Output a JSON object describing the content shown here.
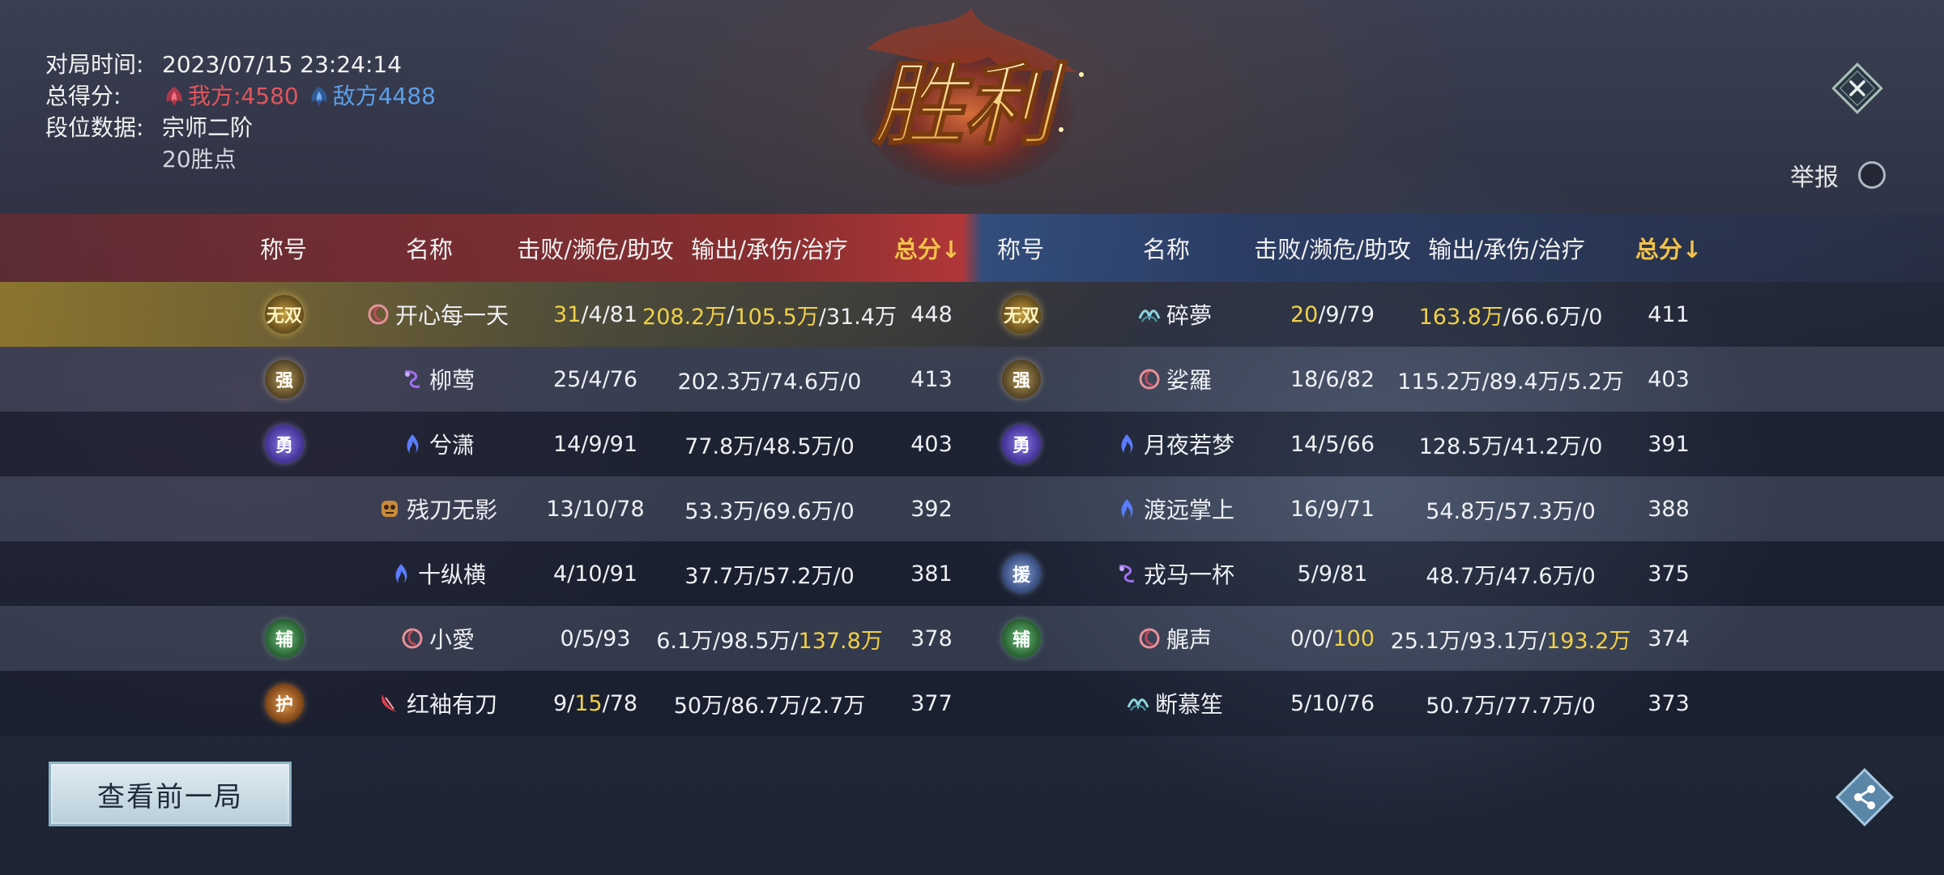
{
  "match": {
    "time_label": "对局时间:",
    "time_value": "2023/07/15 23:24:14",
    "score_label": "总得分:",
    "our_score": "我方:4580",
    "enemy_score": "敌方4488",
    "rank_label": "段位数据:",
    "rank_value": "宗师二阶",
    "rank_points": "20胜点"
  },
  "result": {
    "title": "胜利"
  },
  "report": {
    "label": "举报"
  },
  "headers": {
    "title": "称号",
    "name": "名称",
    "kda": "击败/濒危/助攻",
    "dmg": "输出/承伤/治疗",
    "total": "总分↓"
  },
  "our_team": [
    {
      "badge": "无双",
      "badge_style": "gold",
      "class_icon": "pink-spiral-icon",
      "name": "开心每一天",
      "kda_k": "31",
      "kda_rest": "/4/81",
      "dmg_out": "208.2万",
      "dmg_sep1": "/",
      "dmg_taken": "105.5万",
      "dmg_rest": "/31.4万",
      "total": "448"
    },
    {
      "badge": "强",
      "badge_style": "silver",
      "class_icon": "purple-dragon-icon",
      "name": "柳莺",
      "kda": "25/4/76",
      "dmg": "202.3万/74.6万/0",
      "total": "413"
    },
    {
      "badge": "勇",
      "badge_style": "purple",
      "class_icon": "blue-flame-icon",
      "name": "兮潇",
      "kda": "14/9/91",
      "dmg": "77.8万/48.5万/0",
      "total": "403"
    },
    {
      "badge": "",
      "badge_style": "",
      "class_icon": "orange-mask-icon",
      "name": "残刀无影",
      "kda": "13/10/78",
      "dmg": "53.3万/69.6万/0",
      "total": "392"
    },
    {
      "badge": "",
      "badge_style": "",
      "class_icon": "blue-flame-icon",
      "name": "十纵横",
      "kda": "4/10/91",
      "dmg": "37.7万/57.2万/0",
      "total": "381"
    },
    {
      "badge": "辅",
      "badge_style": "green",
      "class_icon": "pink-spiral-icon",
      "name": "小愛",
      "kda": "0/5/93",
      "dmg_a": "6.1万/98.5万/",
      "dmg_heal": "137.8万",
      "total": "378"
    },
    {
      "badge": "护",
      "badge_style": "orange",
      "class_icon": "red-blade-icon",
      "name": "红袖有刀",
      "kda_a": "9/",
      "kda_hl": "15",
      "kda_b": "/78",
      "dmg": "50万/86.7万/2.7万",
      "total": "377"
    }
  ],
  "enemy_team": [
    {
      "badge": "无双",
      "badge_style": "gold",
      "class_icon": "teal-wave-icon",
      "name": "碎夢",
      "kda_k": "20",
      "kda_rest": "/9/79",
      "dmg_out": "163.8万",
      "dmg_rest": "/66.6万/0",
      "total": "411"
    },
    {
      "badge": "强",
      "badge_style": "silver",
      "class_icon": "pink-spiral-icon",
      "name": "娑羅",
      "kda": "18/6/82",
      "dmg": "115.2万/89.4万/5.2万",
      "total": "403"
    },
    {
      "badge": "勇",
      "badge_style": "purple",
      "class_icon": "blue-flame-icon",
      "name": "月夜若梦",
      "kda": "14/5/66",
      "dmg": "128.5万/41.2万/0",
      "total": "391"
    },
    {
      "badge": "",
      "badge_style": "",
      "class_icon": "blue-flame-icon",
      "name": "渡远掌上",
      "kda": "16/9/71",
      "dmg": "54.8万/57.3万/0",
      "total": "388"
    },
    {
      "badge": "援",
      "badge_style": "blue",
      "class_icon": "purple-dragon-icon",
      "name": "戎马一杯",
      "kda": "5/9/81",
      "dmg": "48.7万/47.6万/0",
      "total": "375"
    },
    {
      "badge": "辅",
      "badge_style": "green",
      "class_icon": "pink-spiral-icon",
      "name": "艉声",
      "kda_a": "0/0/",
      "kda_hl": "100",
      "dmg_a": "25.1万/93.1万/",
      "dmg_heal": "193.2万",
      "total": "374"
    },
    {
      "badge": "",
      "badge_style": "",
      "class_icon": "teal-wave-icon",
      "name": "断慕笙",
      "kda": "5/10/76",
      "dmg": "50.7万/77.7万/0",
      "total": "373"
    }
  ],
  "buttons": {
    "prev_match": "查看前一局",
    "close_icon": "close-icon",
    "share_icon": "share-icon"
  },
  "colors": {
    "highlight": "#f0d048",
    "our_team": "#e0555c",
    "enemy_team": "#5d9ee6"
  }
}
